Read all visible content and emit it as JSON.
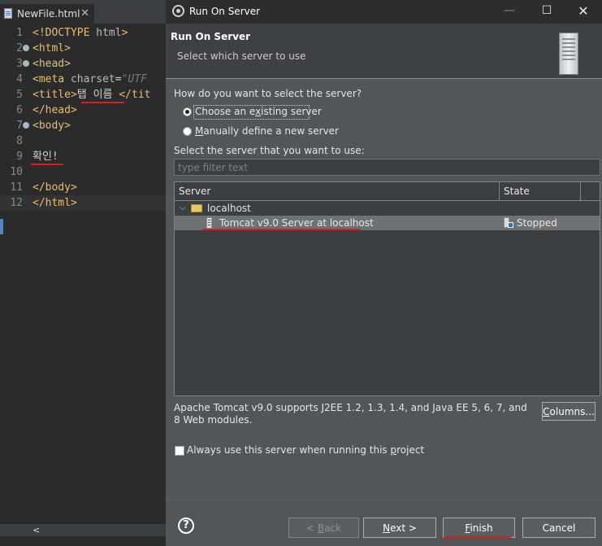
{
  "editor": {
    "tab_label": "NewFile.html",
    "tab_close": "✕",
    "scroll_left_arrow": "<",
    "lines": [
      {
        "num": "1",
        "fold": false,
        "parts": [
          {
            "cls": "brk",
            "t": "<!"
          },
          {
            "cls": "tag",
            "t": "DOCTYPE"
          },
          {
            "cls": "txt",
            "t": " "
          },
          {
            "cls": "attr",
            "t": "html"
          },
          {
            "cls": "brk",
            "t": ">"
          }
        ]
      },
      {
        "num": "2",
        "fold": true,
        "parts": [
          {
            "cls": "brk",
            "t": "<"
          },
          {
            "cls": "tag",
            "t": "html"
          },
          {
            "cls": "brk",
            "t": ">"
          }
        ]
      },
      {
        "num": "3",
        "fold": true,
        "parts": [
          {
            "cls": "brk",
            "t": "<"
          },
          {
            "cls": "tag",
            "t": "head"
          },
          {
            "cls": "brk",
            "t": ">"
          }
        ]
      },
      {
        "num": "4",
        "fold": false,
        "parts": [
          {
            "cls": "brk",
            "t": "<"
          },
          {
            "cls": "tag",
            "t": "meta"
          },
          {
            "cls": "txt",
            "t": " "
          },
          {
            "cls": "attr",
            "t": "charset"
          },
          {
            "cls": "txt",
            "t": "="
          },
          {
            "cls": "str",
            "t": "\"UTF"
          }
        ]
      },
      {
        "num": "5",
        "fold": false,
        "parts": [
          {
            "cls": "brk",
            "t": "<"
          },
          {
            "cls": "tag",
            "t": "title"
          },
          {
            "cls": "brk",
            "t": ">"
          },
          {
            "cls": "txt",
            "t": "탭 이름"
          },
          {
            "cls": "txt",
            "t": " "
          },
          {
            "cls": "brk",
            "t": "</"
          },
          {
            "cls": "tag",
            "t": "tit"
          }
        ]
      },
      {
        "num": "6",
        "fold": false,
        "parts": [
          {
            "cls": "brk",
            "t": "</"
          },
          {
            "cls": "tag",
            "t": "head"
          },
          {
            "cls": "brk",
            "t": ">"
          }
        ]
      },
      {
        "num": "7",
        "fold": true,
        "parts": [
          {
            "cls": "brk",
            "t": "<"
          },
          {
            "cls": "tag",
            "t": "body"
          },
          {
            "cls": "brk",
            "t": ">"
          }
        ]
      },
      {
        "num": "8",
        "fold": false,
        "parts": []
      },
      {
        "num": "9",
        "fold": false,
        "parts": [
          {
            "cls": "txt",
            "t": "확인!"
          }
        ]
      },
      {
        "num": "10",
        "fold": false,
        "parts": []
      },
      {
        "num": "11",
        "fold": false,
        "parts": [
          {
            "cls": "brk",
            "t": "</"
          },
          {
            "cls": "tag",
            "t": "body"
          },
          {
            "cls": "brk",
            "t": ">"
          }
        ]
      },
      {
        "num": "12",
        "fold": false,
        "parts": [
          {
            "cls": "brk",
            "t": "</"
          },
          {
            "cls": "tag",
            "t": "html"
          },
          {
            "cls": "brk",
            "t": ">"
          }
        ]
      }
    ]
  },
  "dialog": {
    "window_title": "Run On Server",
    "win_controls": {
      "minimize": "—",
      "maximize": "☐",
      "close": "✕"
    },
    "header_title": "Run On Server",
    "header_subtitle": "Select which server to use",
    "question": "How do you want to select the server?",
    "radio_existing": {
      "pre": "Choose an e",
      "mn": "x",
      "post": "isting server"
    },
    "radio_manual": {
      "pre": "",
      "mn": "M",
      "post": "anually define a new server"
    },
    "select_label": "Select the server that you want to use:",
    "filter_placeholder": "type filter text",
    "table": {
      "columns": [
        "Server",
        "State"
      ],
      "group": "localhost",
      "rows": [
        {
          "server": "Tomcat v9.0 Server at localhost",
          "state": "Stopped"
        }
      ]
    },
    "description": "Apache Tomcat v9.0 supports J2EE 1.2, 1.3, 1.4, and Java EE 5, 6, 7, and 8 Web modules.",
    "columns_button": {
      "pre": "",
      "mn": "C",
      "post": "olumns..."
    },
    "always_use": {
      "pre": "Always use this server when running this ",
      "mn": "p",
      "post": "roject"
    },
    "help_label": "?",
    "buttons": {
      "back": {
        "pre": "< ",
        "mn": "B",
        "post": "ack"
      },
      "next": {
        "pre": "",
        "mn": "N",
        "post": "ext >"
      },
      "finish": {
        "pre": "",
        "mn": "F",
        "post": "inish"
      },
      "cancel": "Cancel"
    }
  },
  "colors": {
    "annotation_red": "#d81e1e",
    "dialog_bg": "#515658",
    "editor_bg": "#2b2b2b"
  }
}
